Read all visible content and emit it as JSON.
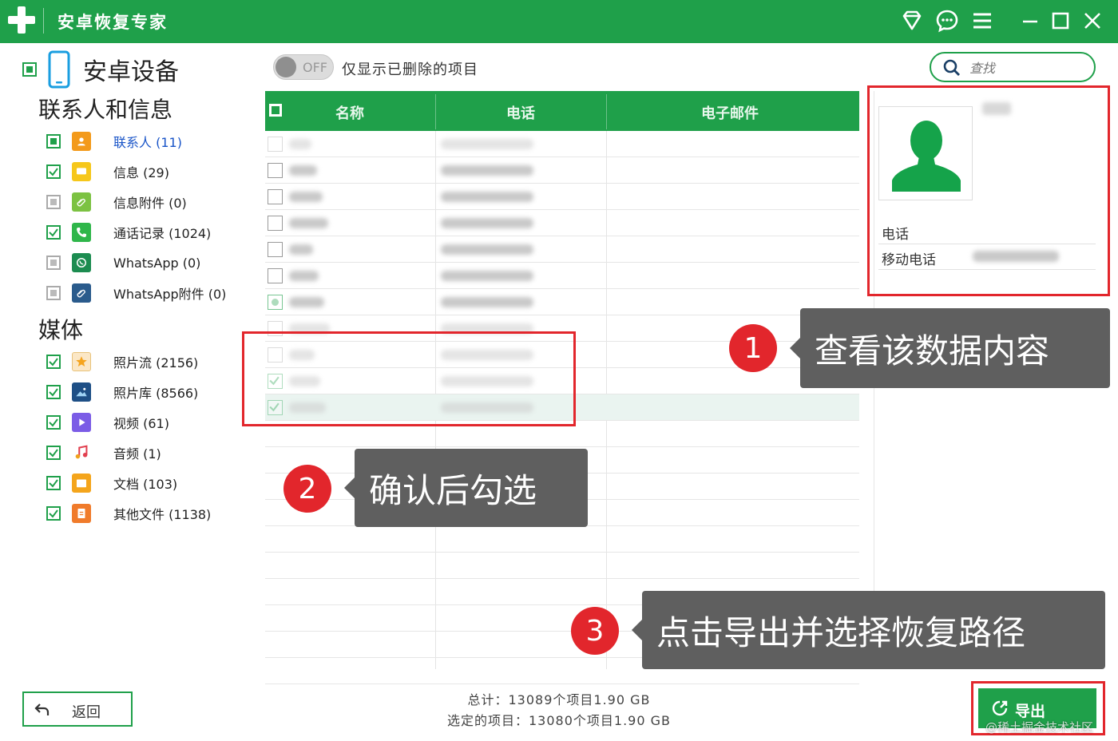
{
  "app": {
    "title": "安卓恢复专家"
  },
  "sidebar": {
    "device": "安卓设备",
    "section_contacts": "联系人和信息",
    "contacts_items": [
      {
        "label": "联系人 (11)",
        "state": "partial"
      },
      {
        "label": "信息 (29)",
        "state": "checked"
      },
      {
        "label": "信息附件 (0)",
        "state": "disabled"
      },
      {
        "label": "通话记录 (1024)",
        "state": "checked"
      },
      {
        "label": "WhatsApp (0)",
        "state": "disabled"
      },
      {
        "label": "WhatsApp附件 (0)",
        "state": "disabled"
      }
    ],
    "section_media": "媒体",
    "media_items": [
      {
        "label": "照片流 (2156)",
        "state": "checked"
      },
      {
        "label": "照片库 (8566)",
        "state": "checked"
      },
      {
        "label": "视频 (61)",
        "state": "checked"
      },
      {
        "label": "音频 (1)",
        "state": "checked"
      },
      {
        "label": "文档 (103)",
        "state": "checked"
      },
      {
        "label": "其他文件 (1138)",
        "state": "checked"
      }
    ]
  },
  "toolbar": {
    "toggle_state": "OFF",
    "toggle_label": "仅显示已删除的项目",
    "search_placeholder": "查找"
  },
  "table": {
    "columns": [
      "名称",
      "电话",
      "电子邮件"
    ]
  },
  "detail": {
    "phone_header": "电话",
    "mobile_label": "移动电话"
  },
  "callouts": [
    {
      "number": "1",
      "text": "查看该数据内容"
    },
    {
      "number": "2",
      "text": "确认后勾选"
    },
    {
      "number": "3",
      "text": "点击导出并选择恢复路径"
    }
  ],
  "footer": {
    "back_label": "返回",
    "total": "总计：13089个项目1.90 GB",
    "selected": "选定的项目：13080个项目1.90 GB",
    "export_label": "导出",
    "watermark": "@稀土掘金技术社区"
  },
  "colors": {
    "brand_green": "#1fa04a",
    "callout_red": "#e2262c",
    "bubble_gray": "#5f5f5f"
  }
}
